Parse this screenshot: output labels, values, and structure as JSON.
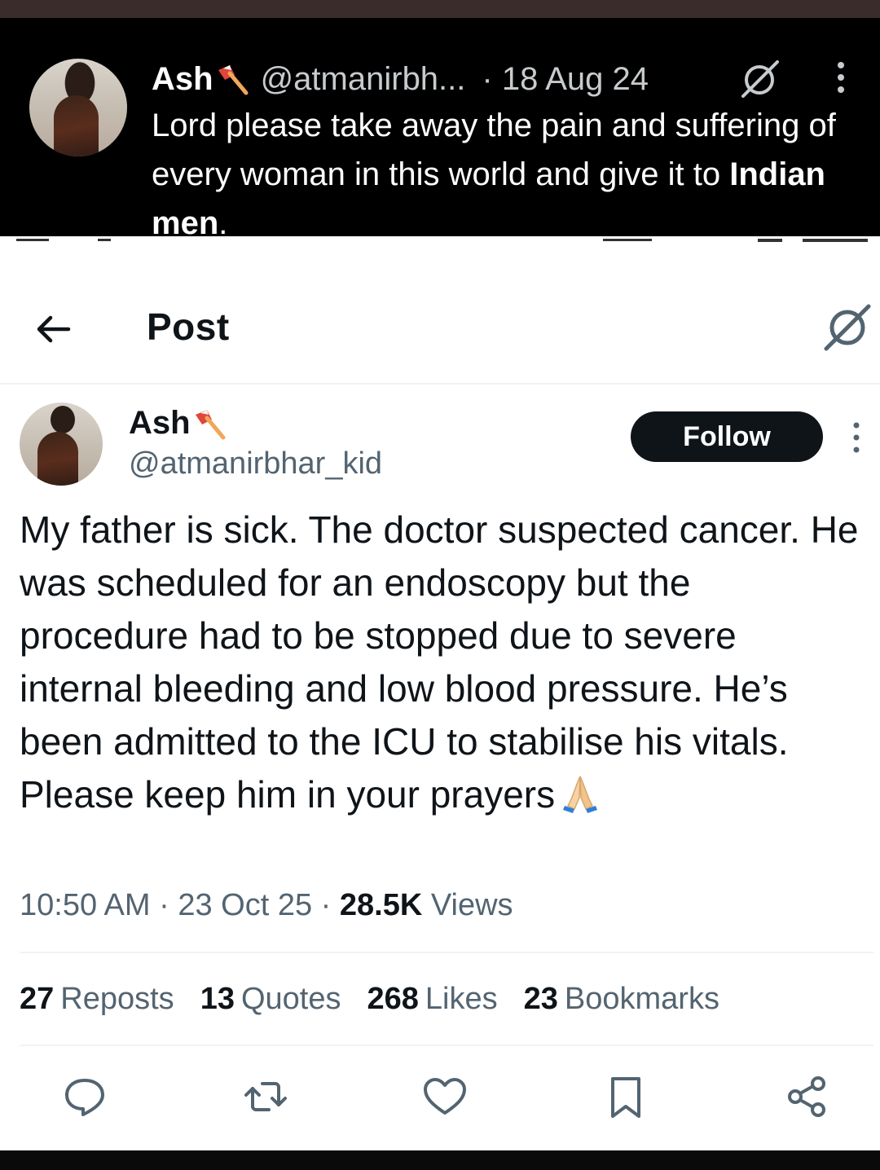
{
  "quoted": {
    "name": "Ash",
    "handle": "@atmanirbh...",
    "date": "· 18 Aug 24",
    "text_before": "Lord please take away the pain and suffering of every woman in this world and give it to ",
    "text_bold": "Indian men",
    "text_after": "."
  },
  "nav": {
    "title": "Post"
  },
  "post": {
    "name": "Ash",
    "handle": "@atmanirbhar_kid",
    "follow_label": "Follow",
    "text": "My father is sick. The doctor suspected cancer. He was scheduled for an endoscopy but the procedure had to be stopped due to severe internal bleeding and low blood pressure. He’s been admitted to the ICU to stabilise his vitals.  Please keep him in your prayers",
    "time": "10:50 AM",
    "date": "23 Oct 25",
    "views_count": "28.5K",
    "views_label": "Views"
  },
  "stats": [
    {
      "count": "27",
      "label": "Reposts"
    },
    {
      "count": "13",
      "label": "Quotes"
    },
    {
      "count": "268",
      "label": "Likes"
    },
    {
      "count": "23",
      "label": "Bookmarks"
    }
  ],
  "icons": {
    "axe": "axe-icon",
    "grok": "grok-icon",
    "more": "more-icon",
    "back": "back-arrow-icon",
    "pray": "praying-hands-icon",
    "reply": "reply-icon",
    "repost": "repost-icon",
    "like": "like-icon",
    "bookmark": "bookmark-icon",
    "share": "share-icon"
  },
  "colors": {
    "text_primary": "#0f1419",
    "text_secondary": "#536471",
    "dark_bg": "#000000"
  }
}
